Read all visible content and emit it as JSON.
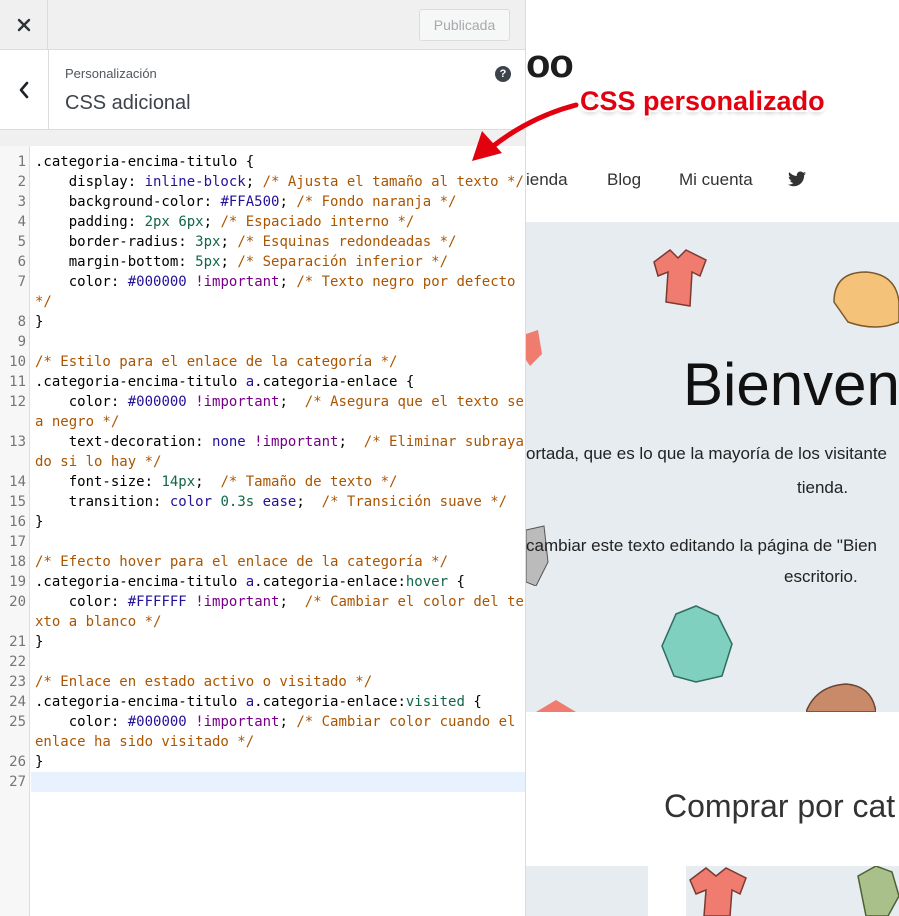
{
  "topbar": {
    "close_icon": "close-icon",
    "publish_label": "Publicada"
  },
  "section": {
    "breadcrumb": "Personalización",
    "title": "CSS adicional",
    "help_icon": "help-icon",
    "back_icon": "chevron-left-icon"
  },
  "annotation": {
    "text": "CSS personalizado",
    "color": "#e3000f"
  },
  "code_lines": [
    {
      "n": "1",
      "tokens": [
        [
          "",
          ".categoria-encima-titulo {"
        ]
      ]
    },
    {
      "n": "2",
      "tokens": [
        [
          "",
          "    display: "
        ],
        [
          "kw",
          "inline-block"
        ],
        [
          "",
          "; "
        ],
        [
          "com",
          "/* Ajusta el tamaño al texto */"
        ]
      ]
    },
    {
      "n": "3",
      "tokens": [
        [
          "",
          "    background-color: "
        ],
        [
          "kw",
          "#FFA500"
        ],
        [
          "",
          "; "
        ],
        [
          "com",
          "/* Fondo naranja */"
        ]
      ]
    },
    {
      "n": "4",
      "tokens": [
        [
          "",
          "    padding: "
        ],
        [
          "num",
          "2px"
        ],
        [
          "",
          " "
        ],
        [
          "num",
          "6px"
        ],
        [
          "",
          "; "
        ],
        [
          "com",
          "/* Espaciado interno */"
        ]
      ]
    },
    {
      "n": "5",
      "tokens": [
        [
          "",
          "    border-radius: "
        ],
        [
          "num",
          "3px"
        ],
        [
          "",
          "; "
        ],
        [
          "com",
          "/* Esquinas redondeadas */"
        ]
      ]
    },
    {
      "n": "6",
      "tokens": [
        [
          "",
          "    margin-bottom: "
        ],
        [
          "num",
          "5px"
        ],
        [
          "",
          "; "
        ],
        [
          "com",
          "/* Separación inferior */"
        ]
      ]
    },
    {
      "n": "7",
      "tokens": [
        [
          "",
          "    color: "
        ],
        [
          "kw",
          "#000000"
        ],
        [
          "",
          " "
        ],
        [
          "imp",
          "!important"
        ],
        [
          "",
          "; "
        ],
        [
          "com",
          "/* Texto negro por defecto */"
        ]
      ]
    },
    {
      "n": "8",
      "tokens": [
        [
          "",
          "}"
        ]
      ]
    },
    {
      "n": "9",
      "tokens": [
        [
          "",
          ""
        ]
      ]
    },
    {
      "n": "10",
      "tokens": [
        [
          "com",
          "/* Estilo para el enlace de la categoría */"
        ]
      ]
    },
    {
      "n": "11",
      "tokens": [
        [
          "",
          ".categoria-encima-titulo "
        ],
        [
          "kw",
          "a"
        ],
        [
          "",
          ".categoria-enlace {"
        ]
      ]
    },
    {
      "n": "12",
      "tokens": [
        [
          "",
          "    color: "
        ],
        [
          "kw",
          "#000000"
        ],
        [
          "",
          " "
        ],
        [
          "imp",
          "!important"
        ],
        [
          "",
          ";  "
        ],
        [
          "com",
          "/* Asegura que el texto sea negro */"
        ]
      ]
    },
    {
      "n": "13",
      "tokens": [
        [
          "",
          "    text-decoration: "
        ],
        [
          "kw",
          "none"
        ],
        [
          "",
          " "
        ],
        [
          "imp",
          "!important"
        ],
        [
          "",
          ";  "
        ],
        [
          "com",
          "/* Eliminar subrayado si lo hay */"
        ]
      ]
    },
    {
      "n": "14",
      "tokens": [
        [
          "",
          "    font-size: "
        ],
        [
          "num",
          "14px"
        ],
        [
          "",
          ";  "
        ],
        [
          "com",
          "/* Tamaño de texto */"
        ]
      ]
    },
    {
      "n": "15",
      "tokens": [
        [
          "",
          "    transition: "
        ],
        [
          "kw",
          "color"
        ],
        [
          "",
          " "
        ],
        [
          "num",
          "0.3s"
        ],
        [
          "",
          " "
        ],
        [
          "kw",
          "ease"
        ],
        [
          "",
          ";  "
        ],
        [
          "com",
          "/* Transición suave */"
        ]
      ]
    },
    {
      "n": "16",
      "tokens": [
        [
          "",
          "}"
        ]
      ]
    },
    {
      "n": "17",
      "tokens": [
        [
          "",
          ""
        ]
      ]
    },
    {
      "n": "18",
      "tokens": [
        [
          "com",
          "/* Efecto hover para el enlace de la categoría */"
        ]
      ]
    },
    {
      "n": "19",
      "tokens": [
        [
          "",
          ".categoria-encima-titulo "
        ],
        [
          "kw",
          "a"
        ],
        [
          "",
          ".categoria-enlace:"
        ],
        [
          "pseudo",
          "hover"
        ],
        [
          "",
          " {"
        ]
      ]
    },
    {
      "n": "20",
      "tokens": [
        [
          "",
          "    color: "
        ],
        [
          "kw",
          "#FFFFFF"
        ],
        [
          "",
          " "
        ],
        [
          "imp",
          "!important"
        ],
        [
          "",
          ";  "
        ],
        [
          "com",
          "/* Cambiar el color del texto a blanco */"
        ]
      ]
    },
    {
      "n": "21",
      "tokens": [
        [
          "",
          "}"
        ]
      ]
    },
    {
      "n": "22",
      "tokens": [
        [
          "",
          ""
        ]
      ]
    },
    {
      "n": "23",
      "tokens": [
        [
          "com",
          "/* Enlace en estado activo o visitado */"
        ]
      ]
    },
    {
      "n": "24",
      "tokens": [
        [
          "",
          ".categoria-encima-titulo "
        ],
        [
          "kw",
          "a"
        ],
        [
          "",
          ".categoria-enlace:"
        ],
        [
          "pseudo",
          "visited"
        ],
        [
          "",
          " {"
        ]
      ]
    },
    {
      "n": "25",
      "tokens": [
        [
          "",
          "    color: "
        ],
        [
          "kw",
          "#000000"
        ],
        [
          "",
          " "
        ],
        [
          "imp",
          "!important"
        ],
        [
          "",
          "; "
        ],
        [
          "com",
          "/* Cambiar color cuando el enlace ha sido visitado */"
        ]
      ]
    },
    {
      "n": "26",
      "tokens": [
        [
          "",
          "}"
        ]
      ]
    },
    {
      "n": "27",
      "tokens": [
        [
          "",
          ""
        ]
      ],
      "active": true
    }
  ],
  "preview": {
    "logo_fragment": "oo",
    "nav": [
      "ienda",
      "Blog",
      "Mi cuenta"
    ],
    "nav_icon": "twitter-icon",
    "hero_title": "Bienveni",
    "hero_lines": [
      "ortada, que es lo que la mayoría de los visitante",
      "tienda.",
      "cambiar este texto editando la página de \"Bien",
      "escritorio."
    ],
    "shop_title": "Comprar por cat"
  }
}
